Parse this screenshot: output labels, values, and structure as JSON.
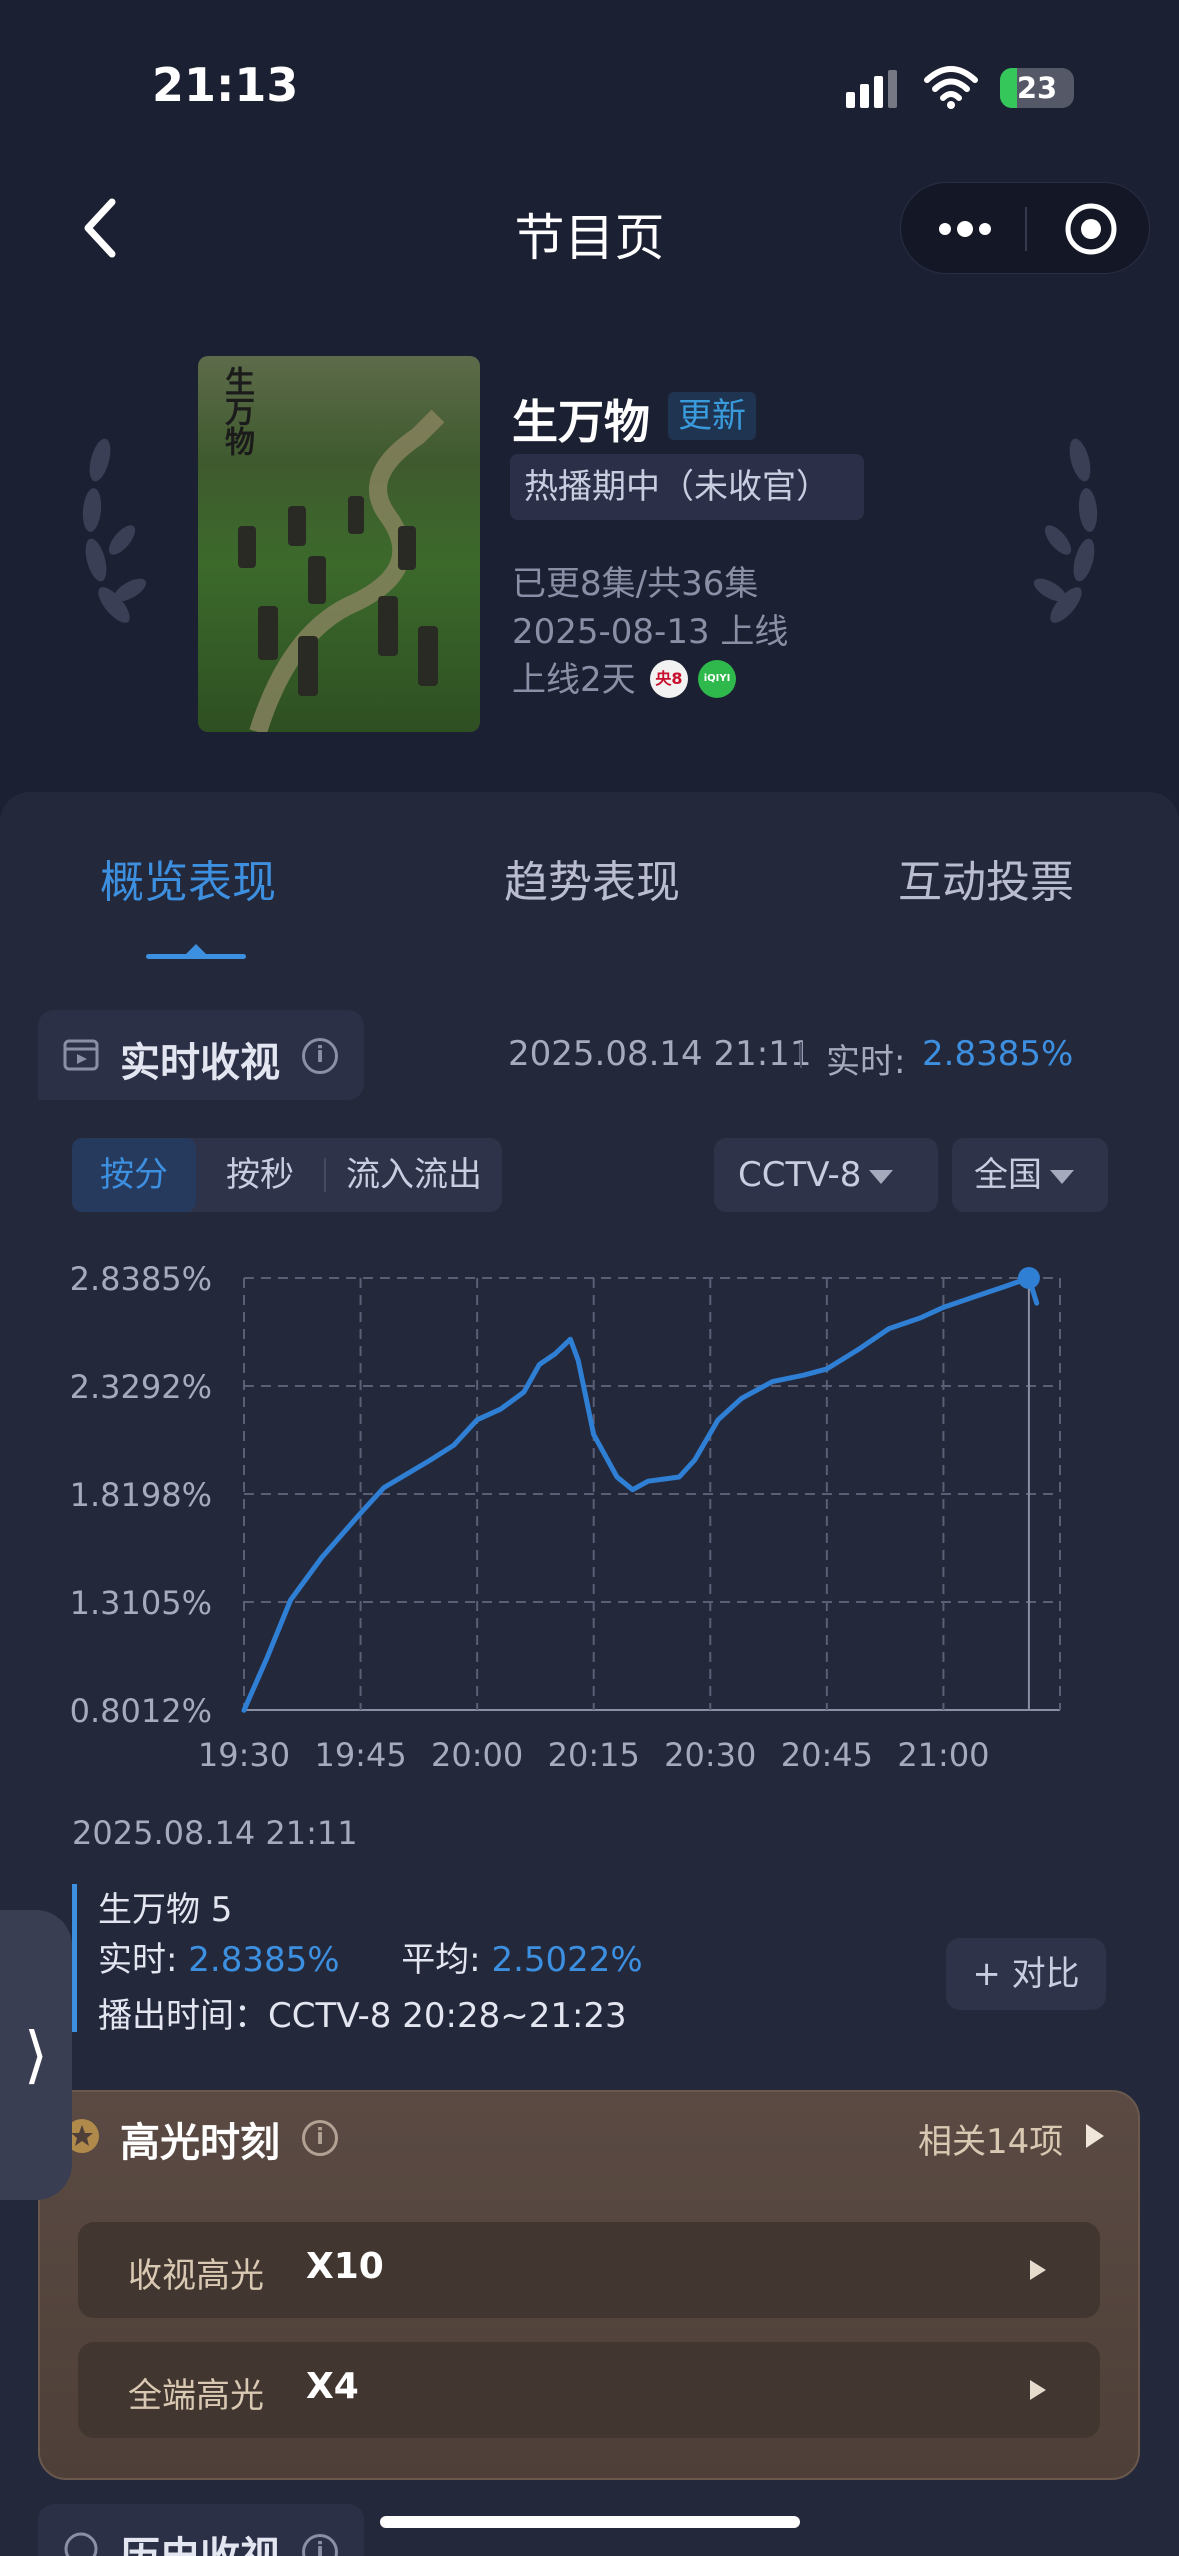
{
  "status_bar": {
    "time": "21:13",
    "battery_level": "23",
    "battery_fraction": 0.23,
    "icons": [
      "signal-icon",
      "wifi-icon",
      "battery-icon"
    ]
  },
  "nav": {
    "title": "节目页",
    "icons": [
      "back-icon",
      "more-icon",
      "target-icon"
    ]
  },
  "show": {
    "poster_text": "生万物",
    "name": "生万物",
    "update_badge": "更新",
    "status": "热播期中（未收官）",
    "episodes": "已更8集/共36集",
    "premiere": "2025-08-13 上线",
    "days_online": "上线2天",
    "channel_icons": [
      {
        "name": "cctv8-icon",
        "label": "央8"
      },
      {
        "name": "iqiyi-icon",
        "label": "iQIYI"
      }
    ]
  },
  "tabs": [
    {
      "label": "概览表现",
      "active": true
    },
    {
      "label": "趋势表现",
      "active": false
    },
    {
      "label": "互动投票",
      "active": false
    }
  ],
  "realtime": {
    "section_title": "实时收视",
    "timestamp": "2025.08.14 21:11",
    "label": "实时:",
    "value": "2.8385%"
  },
  "segments": [
    {
      "label": "按分",
      "active": true
    },
    {
      "label": "按秒",
      "active": false
    },
    {
      "label": "流入流出",
      "active": false
    }
  ],
  "filters": {
    "channel": "CCTV-8",
    "region": "全国"
  },
  "chart_data": {
    "type": "line",
    "x_ticks": [
      "19:30",
      "19:45",
      "20:00",
      "20:15",
      "20:30",
      "20:45",
      "21:00"
    ],
    "y_ticks": [
      "0.8012%",
      "1.3105%",
      "1.8198%",
      "2.3292%",
      "2.8385%"
    ],
    "ylim": [
      0.8012,
      2.8385
    ],
    "xlim": [
      "19:30",
      "21:15"
    ],
    "grid": true,
    "series": [
      {
        "color": "#2f7fd4",
        "points": [
          [
            "19:30",
            0.8
          ],
          [
            "19:33",
            1.05
          ],
          [
            "19:36",
            1.32
          ],
          [
            "19:40",
            1.52
          ],
          [
            "19:45",
            1.73
          ],
          [
            "19:48",
            1.85
          ],
          [
            "19:54",
            1.98
          ],
          [
            "19:57",
            2.05
          ],
          [
            "20:00",
            2.17
          ],
          [
            "20:03",
            2.22
          ],
          [
            "20:06",
            2.3
          ],
          [
            "20:08",
            2.43
          ],
          [
            "20:10",
            2.48
          ],
          [
            "20:12",
            2.55
          ],
          [
            "20:13",
            2.45
          ],
          [
            "20:15",
            2.1
          ],
          [
            "20:18",
            1.9
          ],
          [
            "20:20",
            1.84
          ],
          [
            "20:22",
            1.88
          ],
          [
            "20:26",
            1.9
          ],
          [
            "20:28",
            1.98
          ],
          [
            "20:31",
            2.17
          ],
          [
            "20:34",
            2.27
          ],
          [
            "20:38",
            2.35
          ],
          [
            "20:42",
            2.38
          ],
          [
            "20:45",
            2.41
          ],
          [
            "20:49",
            2.5
          ],
          [
            "20:53",
            2.6
          ],
          [
            "20:57",
            2.65
          ],
          [
            "21:00",
            2.7
          ],
          [
            "21:04",
            2.75
          ],
          [
            "21:08",
            2.8
          ],
          [
            "21:11",
            2.8385
          ],
          [
            "21:12",
            2.72
          ]
        ]
      }
    ],
    "marker": [
      "21:11",
      2.8385
    ]
  },
  "tooltip": {
    "timestamp": "2025.08.14 21:11",
    "name": "生万物 5",
    "realtime_label": "实时:",
    "realtime_value": "2.8385%",
    "avg_label": "平均:",
    "avg_value": "2.5022%",
    "airtime": "播出时间：CCTV-8 20:28~21:23",
    "compare_button": "+ 对比"
  },
  "side_tab": {
    "label": "⟩"
  },
  "highlights": {
    "title": "高光时刻",
    "related": "相关14项",
    "rows": [
      {
        "label": "收视高光",
        "value": "X10"
      },
      {
        "label": "全端高光",
        "value": "X4"
      }
    ]
  },
  "history": {
    "title": "历史收视"
  }
}
